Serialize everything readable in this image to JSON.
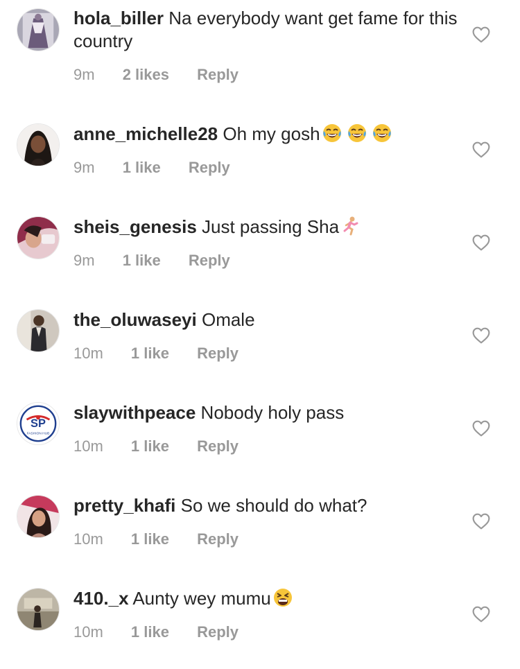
{
  "comments": [
    {
      "username": "hola_biller",
      "text": "Na everybody want get fame for this country",
      "time": "9m",
      "likes": "2 likes",
      "reply": "Reply",
      "emoji": []
    },
    {
      "username": "anne_michelle28",
      "text": "Oh my gosh",
      "time": "9m",
      "likes": "1 like",
      "reply": "Reply",
      "emoji": [
        "face-with-tears-of-joy",
        "face-with-tears-of-joy",
        "face-with-tears-of-joy"
      ]
    },
    {
      "username": "sheis_genesis",
      "text": "Just passing Sha",
      "time": "9m",
      "likes": "1 like",
      "reply": "Reply",
      "emoji": [
        "person-running"
      ]
    },
    {
      "username": "the_oluwaseyi",
      "text": "Omale",
      "time": "10m",
      "likes": "1 like",
      "reply": "Reply",
      "emoji": []
    },
    {
      "username": "slaywithpeace",
      "text": "Nobody holy pass",
      "time": "10m",
      "likes": "1 like",
      "reply": "Reply",
      "emoji": [],
      "avatar_logo": "SP",
      "avatar_logo_sub": "FASHION HUB"
    },
    {
      "username": "pretty_khafi",
      "text": "So we should do what?",
      "time": "10m",
      "likes": "1 like",
      "reply": "Reply",
      "emoji": []
    },
    {
      "username": "410._x",
      "text": "Aunty wey mumu",
      "time": "10m",
      "likes": "1 like",
      "reply": "Reply",
      "emoji": [
        "tired-face"
      ]
    }
  ],
  "icons": {
    "like": "heart-outline-icon"
  },
  "colors": {
    "text": "#262626",
    "meta": "#999999",
    "icon": "#999999",
    "logo_blue": "#1f3f8f",
    "logo_red": "#d42a2a"
  }
}
